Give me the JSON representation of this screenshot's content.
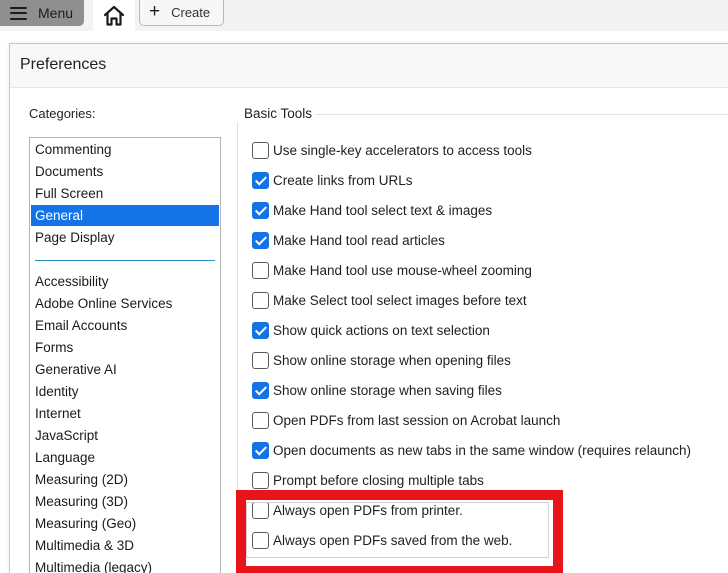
{
  "toolbar": {
    "menu_label": "Menu",
    "create_label": "Create",
    "create_icon": "+"
  },
  "dialog": {
    "title": "Preferences",
    "categories_label": "Categories:",
    "categories_top": [
      "Commenting",
      "Documents",
      "Full Screen",
      "General",
      "Page Display"
    ],
    "categories_rest": [
      "Accessibility",
      "Adobe Online Services",
      "Email Accounts",
      "Forms",
      "Generative AI",
      "Identity",
      "Internet",
      "JavaScript",
      "Language",
      "Measuring (2D)",
      "Measuring (3D)",
      "Measuring (Geo)",
      "Multimedia & 3D",
      "Multimedia (legacy)"
    ],
    "selected_category": "General",
    "section_title": "Basic Tools",
    "options": [
      {
        "label": "Use single-key accelerators to access tools",
        "checked": false
      },
      {
        "label": "Create links from URLs",
        "checked": true
      },
      {
        "label": "Make Hand tool select text & images",
        "checked": true
      },
      {
        "label": "Make Hand tool read articles",
        "checked": true
      },
      {
        "label": "Make Hand tool use mouse-wheel zooming",
        "checked": false
      },
      {
        "label": "Make Select tool select images before text",
        "checked": false
      },
      {
        "label": "Show quick actions on text selection",
        "checked": true
      },
      {
        "label": "Show online storage when opening files",
        "checked": false
      },
      {
        "label": "Show online storage when saving files",
        "checked": true
      },
      {
        "label": "Open PDFs from last session on Acrobat launch",
        "checked": false
      },
      {
        "label": "Open documents as new tabs in the same window (requires relaunch)",
        "checked": true
      },
      {
        "label": "Prompt before closing multiple tabs",
        "checked": false
      },
      {
        "label": "Always open PDFs from printer.",
        "checked": false
      },
      {
        "label": "Always open PDFs saved from the web.",
        "checked": false
      }
    ]
  },
  "colors": {
    "accent": "#1473e6",
    "highlight": "#e8141c"
  }
}
